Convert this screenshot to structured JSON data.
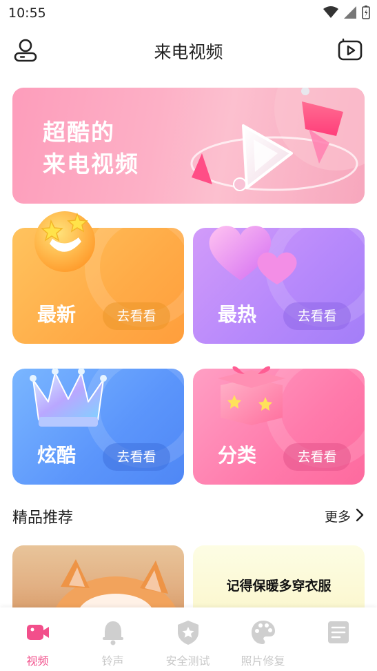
{
  "status_bar": {
    "time": "10:55"
  },
  "header": {
    "title": "来电视频"
  },
  "banner": {
    "line1": "超酷的",
    "line2": "来电视频"
  },
  "categories": [
    {
      "name": "最新",
      "action": "去看看"
    },
    {
      "name": "最热",
      "action": "去看看"
    },
    {
      "name": "炫酷",
      "action": "去看看"
    },
    {
      "name": "分类",
      "action": "去看看"
    }
  ],
  "featured": {
    "title": "精品推荐",
    "more": "更多",
    "items": [
      {
        "caption": ""
      },
      {
        "caption": "记得保暖多穿衣服"
      }
    ]
  },
  "nav": {
    "items": [
      {
        "label": "视频",
        "icon": "video-camera-icon",
        "active": true
      },
      {
        "label": "铃声",
        "icon": "bell-icon",
        "active": false
      },
      {
        "label": "安全测试",
        "icon": "shield-star-icon",
        "active": false
      },
      {
        "label": "照片修复",
        "icon": "palette-icon",
        "active": false
      },
      {
        "label": "",
        "icon": "checklist-icon",
        "active": false
      }
    ]
  },
  "colors": {
    "accent": "#f24f8b",
    "inactive": "#c8c8c8"
  }
}
